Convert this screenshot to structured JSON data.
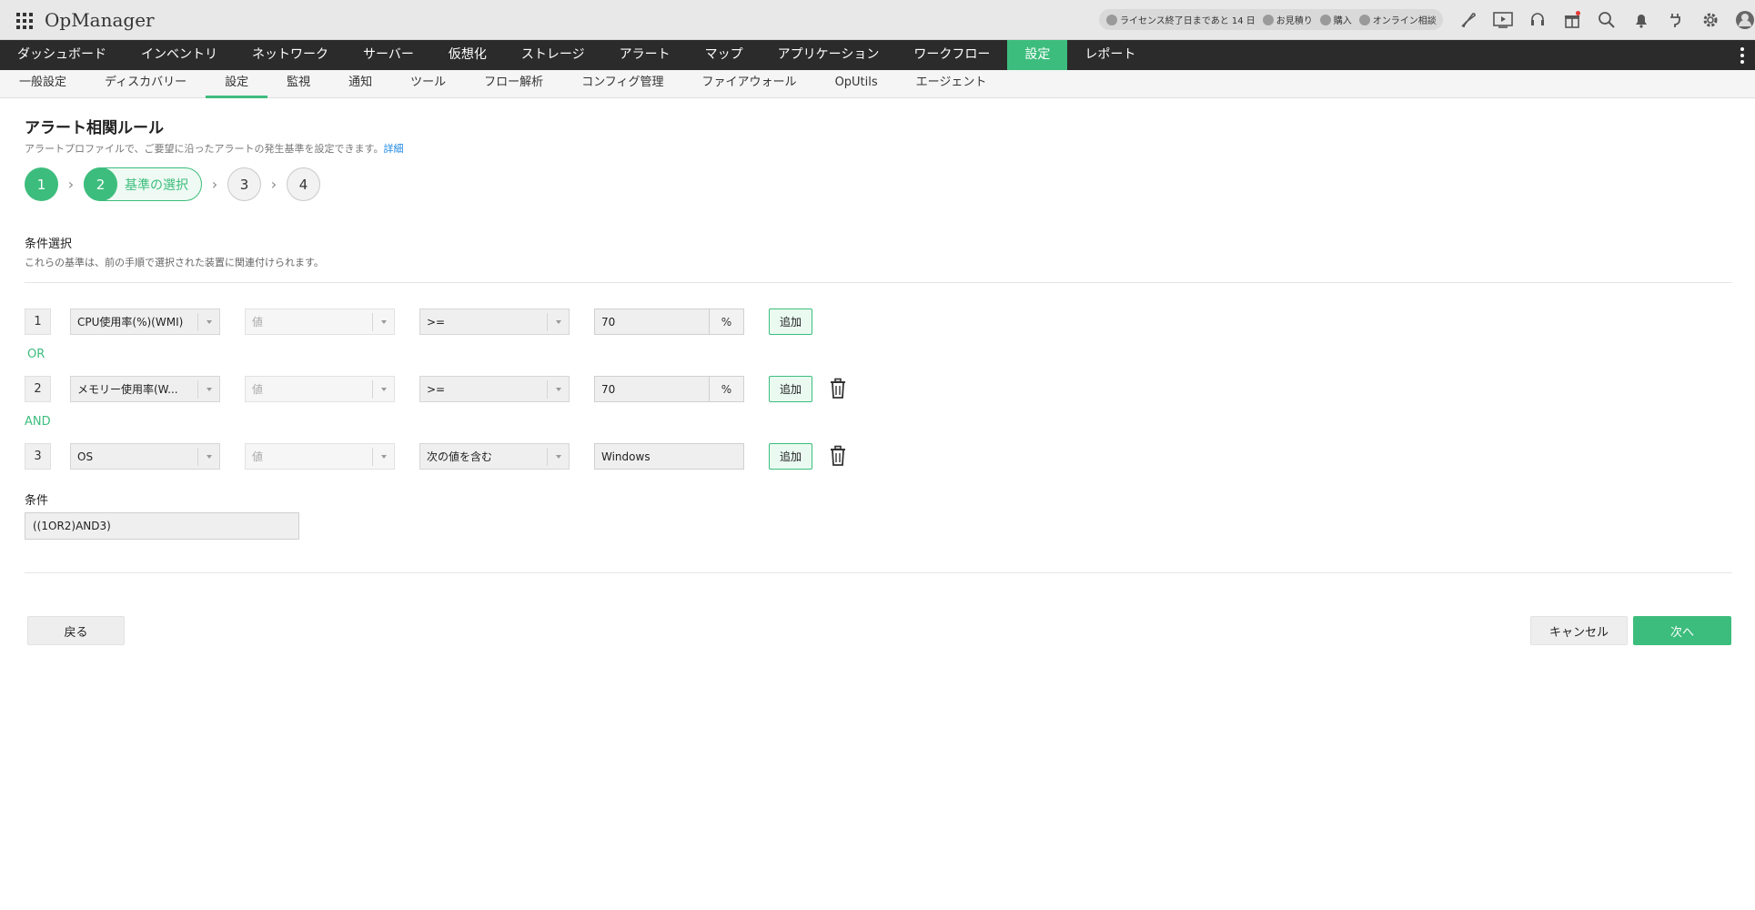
{
  "header": {
    "app_title": "OpManager",
    "license_items": [
      {
        "label": "ライセンス終了日まであと 14 日"
      },
      {
        "label": "お見積り"
      },
      {
        "label": "購入"
      },
      {
        "label": "オンライン相談"
      }
    ],
    "icons": [
      "rocket-icon",
      "video-icon",
      "headset-icon",
      "gift-icon",
      "search-icon",
      "bell-icon",
      "plug-icon",
      "gear-icon",
      "user-icon"
    ]
  },
  "main_nav": {
    "items": [
      "ダッシュボード",
      "インベントリ",
      "ネットワーク",
      "サーバー",
      "仮想化",
      "ストレージ",
      "アラート",
      "マップ",
      "アプリケーション",
      "ワークフロー",
      "設定",
      "レポート"
    ],
    "active": "設定"
  },
  "sub_nav": {
    "items": [
      "一般設定",
      "ディスカバリー",
      "設定",
      "監視",
      "通知",
      "ツール",
      "フロー解析",
      "コンフィグ管理",
      "ファイアウォール",
      "OpUtils",
      "エージェント"
    ],
    "active": "設定"
  },
  "page": {
    "title": "アラート相関ルール",
    "description": "アラートプロファイルで、ご要望に沿ったアラートの発生基準を設定できます。",
    "details_link": "詳細"
  },
  "steps": [
    {
      "number": "1",
      "label": ""
    },
    {
      "number": "2",
      "label": "基準の選択"
    },
    {
      "number": "3",
      "label": ""
    },
    {
      "number": "4",
      "label": ""
    }
  ],
  "criteria": {
    "title": "条件選択",
    "description": "これらの基準は、前の手順で選択された装置に関連付けられます。",
    "rows": [
      {
        "number": "1",
        "metric": "CPU使用率(%)(WMI)",
        "value_type": "値",
        "operator": ">=",
        "value": "70",
        "unit": "%",
        "add_label": "追加"
      },
      {
        "number": "2",
        "metric": "メモリー使用率(W...",
        "value_type": "値",
        "operator": ">=",
        "value": "70",
        "unit": "%",
        "add_label": "追加"
      },
      {
        "number": "3",
        "metric": "OS",
        "value_type": "値",
        "operator": "次の値を含む",
        "value": "Windows",
        "unit": "",
        "add_label": "追加"
      }
    ],
    "operators_between": [
      "OR",
      "AND"
    ]
  },
  "condition": {
    "label": "条件",
    "value": "((1OR2)AND3)"
  },
  "footer": {
    "back_label": "戻る",
    "cancel_label": "キャンセル",
    "next_label": "次へ"
  },
  "colors": {
    "accent": "#3dbd7d",
    "nav_bg": "#2b2b2b",
    "link": "#1e88e5"
  }
}
